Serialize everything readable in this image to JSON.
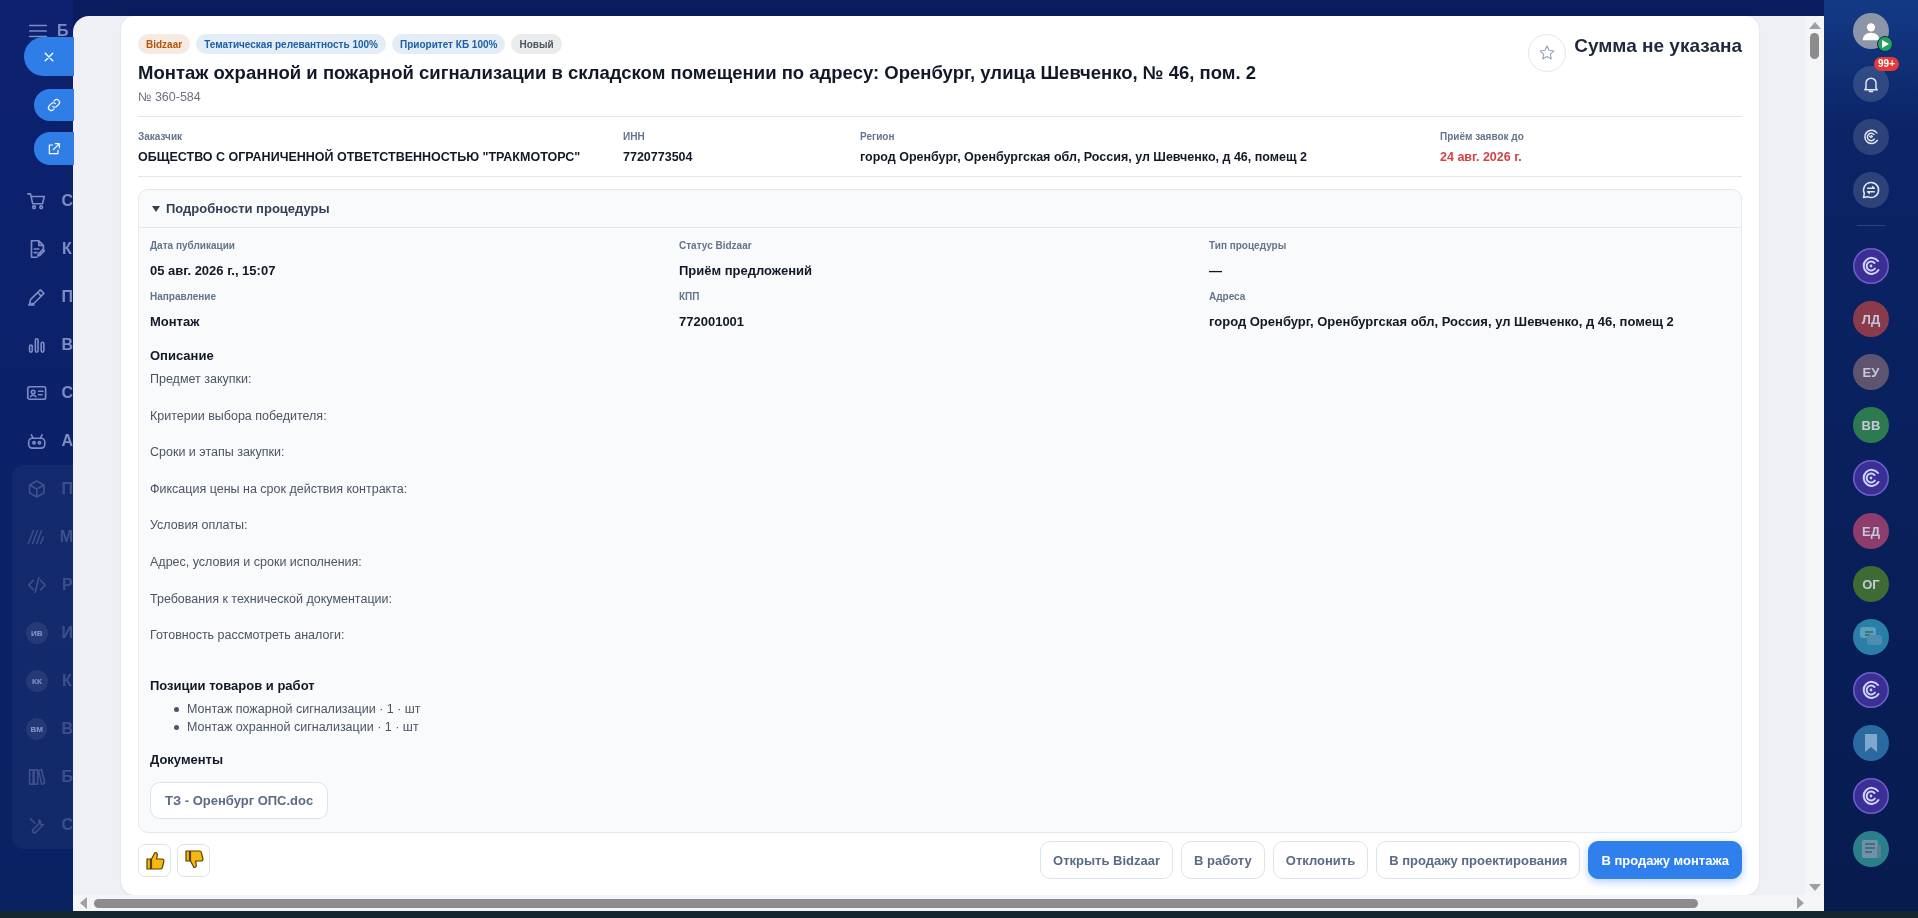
{
  "left_sidebar": {
    "title": "Б",
    "items": [
      {
        "label": "С"
      },
      {
        "label": "К"
      },
      {
        "label": "П"
      },
      {
        "label": "В"
      },
      {
        "label": "С"
      },
      {
        "label": "А"
      }
    ],
    "section_items": [
      {
        "kind": "icon",
        "label": "П"
      },
      {
        "kind": "icon",
        "label": "М"
      },
      {
        "kind": "icon",
        "label": "Р"
      },
      {
        "kind": "avatar",
        "initials": "ИВ",
        "label": "И"
      },
      {
        "kind": "avatar",
        "initials": "КК",
        "label": "К"
      },
      {
        "kind": "avatar",
        "initials": "ВМ",
        "label": "В"
      },
      {
        "kind": "icon",
        "label": "Б"
      },
      {
        "kind": "icon",
        "label": "С"
      }
    ]
  },
  "card": {
    "tags": [
      {
        "label": "Bidzaar",
        "color": "#b45309"
      },
      {
        "label": "Тематическая релевантность 100%",
        "color": "#1d5fa8"
      },
      {
        "label": "Приоритет КБ 100%",
        "color": "#1d5fa8"
      },
      {
        "label": "Новый",
        "color": "#4b5563"
      }
    ],
    "title": "Монтаж охранной и пожарной сигнализации в складском помещении по адресу: Оренбург, улица Шевченко, № 46, пом. 2",
    "number": "№ 360-584",
    "price": "Сумма не указана",
    "info": [
      {
        "label": "Заказчик",
        "value": "ОБЩЕСТВО С ОГРАНИЧЕННОЙ ОТВЕТСТВЕННОСТЬЮ \"ТРАКМОТОРС\"",
        "urgent": false
      },
      {
        "label": "ИНН",
        "value": "7720773504",
        "urgent": false
      },
      {
        "label": "Регион",
        "value": "город Оренбург, Оренбургская обл, Россия, ул Шевченко, д 46, помещ 2",
        "urgent": false
      },
      {
        "label": "Приём заявок до",
        "value": "24 авг. 2026 г.",
        "urgent": true
      }
    ],
    "details": {
      "title": "Подробности процедуры",
      "expanded": true,
      "fields": [
        {
          "label": "Дата публикации",
          "value": "05 авг. 2026 г., 15:07"
        },
        {
          "label": "Статус Bidzaar",
          "value": "Приём предложений"
        },
        {
          "label": "Тип процедуры",
          "value": "—"
        },
        {
          "label": "Направление",
          "value": "Монтаж"
        },
        {
          "label": "КПП",
          "value": "772001001"
        },
        {
          "label": "Адреса",
          "value": "город Оренбург, Оренбургская обл, Россия, ул Шевченко, д 46, помещ 2"
        }
      ],
      "description": {
        "heading": "Описание",
        "lines": [
          "Предмет закупки:",
          "Критерии выбора победителя:",
          "Сроки и этапы закупки:",
          "Фиксация цены на срок действия контракта:",
          "Условия оплаты:",
          "Адрес, условия и сроки исполнения:",
          "Требования к технической документации:",
          "Готовность рассмотреть аналоги:"
        ]
      },
      "positions": {
        "heading": "Позиции товаров и работ",
        "items": [
          "Монтаж пожарной сигнализации · 1 · шт",
          "Монтаж охранной сигнализации · 1 · шт"
        ]
      },
      "documents": {
        "heading": "Документы",
        "files": [
          "ТЗ - Оренбург ОПС.doc"
        ]
      }
    },
    "actions": [
      {
        "label": "Открыть Bidzaar",
        "primary": false
      },
      {
        "label": "В работу",
        "primary": false
      },
      {
        "label": "Отклонить",
        "primary": false
      },
      {
        "label": "В продажу проектирования",
        "primary": false
      },
      {
        "label": "В продажу монтажа",
        "primary": true
      }
    ]
  },
  "right_sidebar": {
    "top": [
      {
        "kind": "user"
      },
      {
        "kind": "bell",
        "badge": "99+"
      },
      {
        "kind": "orbit"
      },
      {
        "kind": "exchange"
      }
    ],
    "items": [
      {
        "kind": "logo"
      },
      {
        "kind": "initials",
        "label": "ЛД",
        "color": "#8a3b4b"
      },
      {
        "kind": "initials",
        "label": "ЕУ",
        "color": "#5f5470"
      },
      {
        "kind": "initials",
        "label": "ВВ",
        "color": "#2e7a50"
      },
      {
        "kind": "logo"
      },
      {
        "kind": "initials",
        "label": "ЕД",
        "color": "#8c3d6e"
      },
      {
        "kind": "initials",
        "label": "ОГ",
        "color": "#3d6b33"
      },
      {
        "kind": "chat"
      },
      {
        "kind": "logo"
      },
      {
        "kind": "bookmark"
      },
      {
        "kind": "logo"
      },
      {
        "kind": "news"
      }
    ]
  }
}
